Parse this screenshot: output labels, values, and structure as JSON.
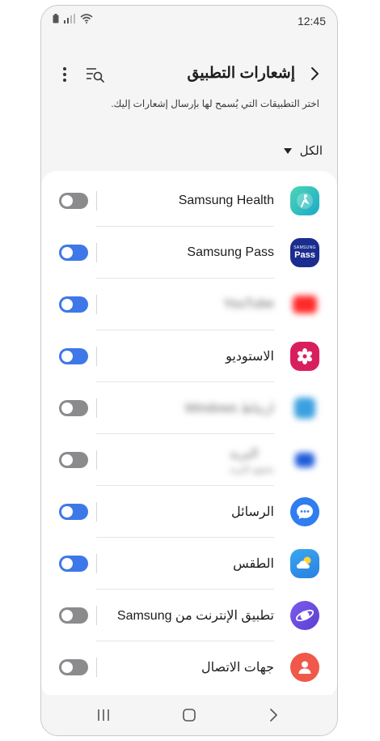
{
  "status": {
    "time": "12:45"
  },
  "header": {
    "title": "إشعارات التطبيق"
  },
  "description": "اختر التطبيقات التي يُسمح لها بإرسال إشعارات إليك.",
  "filter": {
    "label": "الكل"
  },
  "colors": {
    "toggle_on": "#3e78e8",
    "toggle_off": "#8b8b8e",
    "accent": "#3e78e8"
  },
  "apps": [
    {
      "name": "Samsung Health",
      "icon": "samsung-health-icon",
      "enabled": false
    },
    {
      "name": "Samsung Pass",
      "icon": "samsung-pass-icon",
      "icon_text": "SAMSUNG",
      "icon_text2": "Pass",
      "enabled": true
    },
    {
      "name": "YouTube",
      "icon": "youtube-icon",
      "enabled": true,
      "blurred": true
    },
    {
      "name": "الاستوديو",
      "icon": "gallery-icon",
      "enabled": true
    },
    {
      "name": "ارتباط Windows",
      "icon": "link-to-windows-icon",
      "enabled": false,
      "blurred": true
    },
    {
      "name": "البريد",
      "sub": "يحتوي البريد",
      "icon": "email-icon",
      "enabled": false,
      "blurred": true
    },
    {
      "name": "الرسائل",
      "icon": "messages-icon",
      "enabled": true
    },
    {
      "name": "الطقس",
      "icon": "weather-icon",
      "enabled": true
    },
    {
      "name": "تطبيق الإنترنت من Samsung",
      "icon": "samsung-internet-icon",
      "enabled": false
    },
    {
      "name": "جهات الاتصال",
      "icon": "contacts-icon",
      "enabled": false
    }
  ]
}
